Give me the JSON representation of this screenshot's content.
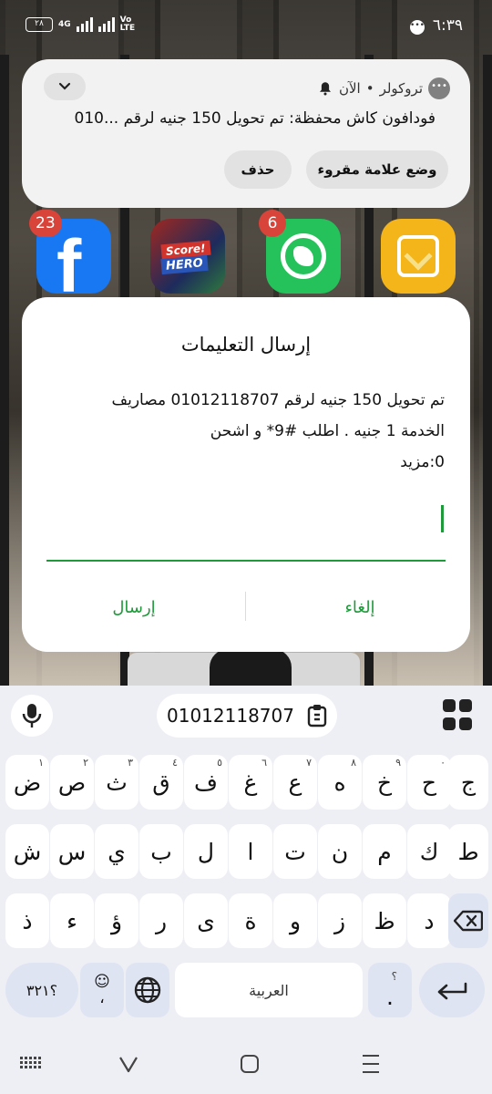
{
  "status_bar": {
    "time": "٦:٣٩",
    "battery": "٢٨",
    "network": "4G",
    "volte": "Vo LTE"
  },
  "notification": {
    "app_name": "تروكولر",
    "separator": "•",
    "time": "الآن",
    "message": "فودافون كاش محفظة: تم تحويل 150 جنيه لرقم ...010",
    "mark_read_label": "وضع علامة مقروء",
    "delete_label": "حذف"
  },
  "home_apps": [
    {
      "name": "Facebook",
      "badge": "23"
    },
    {
      "name": "Score! Hero",
      "label_1": "Score!",
      "label_2": "HERO"
    },
    {
      "name": "WhatsApp",
      "badge": "6"
    },
    {
      "name": "Yellow app"
    }
  ],
  "dialog": {
    "title": "إرسال التعليمات",
    "body_line1": "تم تحويل 150 جنيه لرقم 01012118707 مصاريف",
    "body_line2": "الخدمة 1 جنيه . اطلب #9* و اشحن",
    "body_line3": "0:مزيد",
    "input_value": "",
    "cancel_label": "إلغاء",
    "send_label": "إرسال"
  },
  "keyboard": {
    "clipboard_text": "01012118707",
    "row1": [
      {
        "char": "ض",
        "hint": "١"
      },
      {
        "char": "ص",
        "hint": "٢"
      },
      {
        "char": "ث",
        "hint": "٣"
      },
      {
        "char": "ق",
        "hint": "٤"
      },
      {
        "char": "ف",
        "hint": "٥"
      },
      {
        "char": "غ",
        "hint": "٦"
      },
      {
        "char": "ع",
        "hint": "٧"
      },
      {
        "char": "ه",
        "hint": "٨"
      },
      {
        "char": "خ",
        "hint": "٩"
      },
      {
        "char": "ح",
        "hint": "٠"
      },
      {
        "char": "ج",
        "hint": ""
      }
    ],
    "row2": [
      "ش",
      "س",
      "ي",
      "ب",
      "ل",
      "ا",
      "ت",
      "ن",
      "م",
      "ك",
      "ط"
    ],
    "row3": [
      "ذ",
      "ء",
      "ؤ",
      "ر",
      "ى",
      "ة",
      "و",
      "ز",
      "ظ",
      "د"
    ],
    "symbols_label": "؟٣٢١",
    "emoji_label": "☺",
    "comma_label": "،",
    "space_label": "العربية",
    "period_label": ".",
    "period_hint": "؟"
  },
  "colors": {
    "accent": "#1e9a3a",
    "badge": "#d9443a",
    "keyboard_bg": "#eeeef5"
  }
}
